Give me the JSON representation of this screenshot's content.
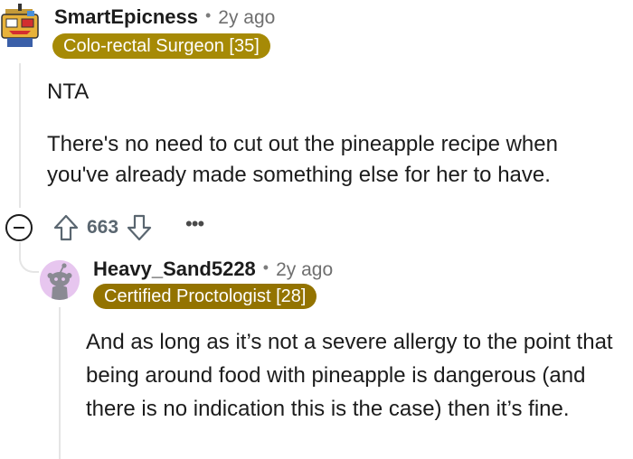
{
  "comment": {
    "username": "SmartEpicness",
    "separator": "•",
    "time": "2y ago",
    "flair": "Colo-rectal Surgeon [35]",
    "paragraphs": [
      "NTA",
      "There's no need to cut out the pineapple recipe when you've already made something else for her to have."
    ],
    "score": "663",
    "more_label": "•••"
  },
  "reply": {
    "username": "Heavy_Sand5228",
    "separator": "•",
    "time": "2y ago",
    "flair": "Certified Proctologist [28]",
    "text": "And as long as it’s not a severe allergy to the point that being around food with pineapple is dangerous (and there is no indication this is the case) then it’s fine."
  },
  "colors": {
    "flair_1": "#a68a06",
    "flair_2": "#937300",
    "score_text": "#5a6670",
    "thread_line": "#e5e5e5"
  },
  "icons": [
    "avatar-robot-icon",
    "collapse-minus-icon",
    "upvote-arrow-icon",
    "downvote-arrow-icon",
    "more-options-icon",
    "avatar-snoo-icon"
  ]
}
